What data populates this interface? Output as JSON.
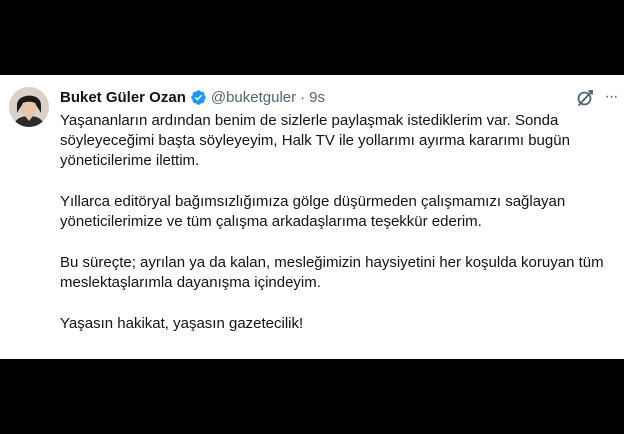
{
  "tweet": {
    "author_name": "Buket Güler Ozan",
    "handle": "@buketguler",
    "separator": "·",
    "time": "9s",
    "verified_color": "#1d9bf0",
    "paragraphs": [
      "Yaşananların ardından benim de sizlerle paylaşmak istediklerim var. Sonda söyleyeceğimi başta söyleyeyim, Halk TV ile yollarımı ayırma kararımı bugün yöneticilerime ilettim.",
      "Yıllarca editöryal bağımsızlığımıza gölge düşürmeden çalışmamızı sağlayan yöneticilerimize ve tüm çalışma arkadaşlarıma teşekkür ederim.",
      "Bu süreçte; ayrılan ya da kalan, mesleğimizin haysiyetini her koşulda koruyan tüm meslektaşlarımla dayanışma içindeyim.",
      "Yaşasın hakikat, yaşasın gazetecilik!"
    ]
  },
  "icons": {
    "avatar": "profile-photo",
    "verified": "verified-badge-icon",
    "grok": "grok-icon",
    "more": "more-icon",
    "more_glyph": "···"
  }
}
